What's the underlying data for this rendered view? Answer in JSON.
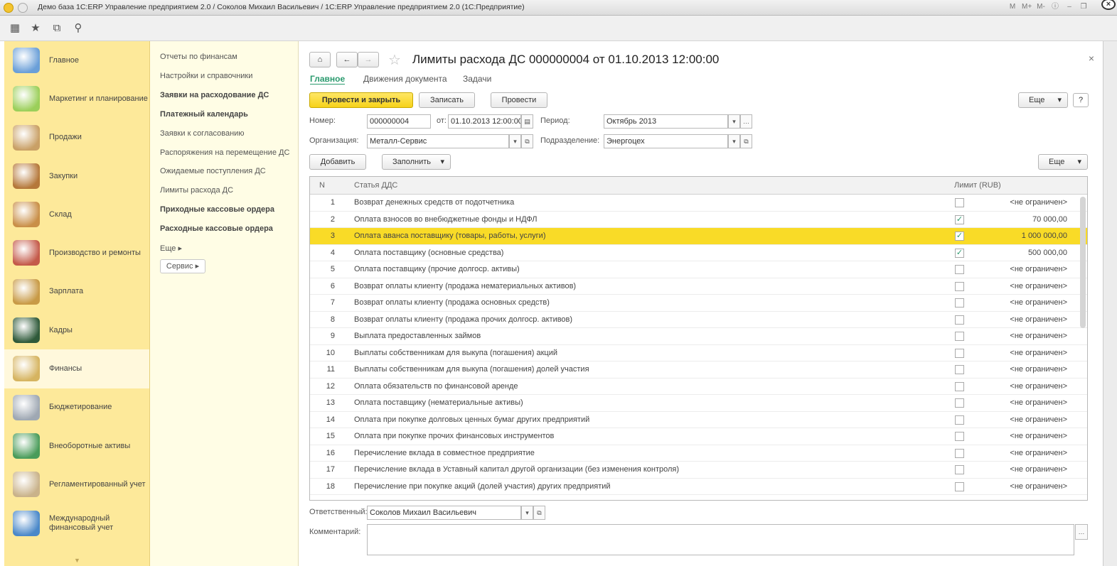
{
  "window": {
    "title": "Демо база 1С:ERP Управление предприятием 2.0 / Соколов Михаил Васильевич / 1С:ERP Управление предприятием 2.0 (1С:Предприятие)",
    "tools": [
      "M",
      "M+",
      "M-"
    ]
  },
  "sections": [
    {
      "label": "Главное",
      "icon": "home-desk-icon",
      "color": "#6a9fd8"
    },
    {
      "label": "Маркетинг и планирование",
      "icon": "pie-chart-icon",
      "color": "#9bcf5a"
    },
    {
      "label": "Продажи",
      "icon": "truck-icon",
      "color": "#c9a066"
    },
    {
      "label": "Закупки",
      "icon": "boxes-icon",
      "color": "#b5783a"
    },
    {
      "label": "Склад",
      "icon": "warehouse-shelf-icon",
      "color": "#c98f48"
    },
    {
      "label": "Производство и ремонты",
      "icon": "factory-icon",
      "color": "#c45a4a"
    },
    {
      "label": "Зарплата",
      "icon": "abacus-icon",
      "color": "#c89a46"
    },
    {
      "label": "Кадры",
      "icon": "passport-icon",
      "color": "#2f5a3a"
    },
    {
      "label": "Финансы",
      "icon": "coins-icon",
      "color": "#d6b460"
    },
    {
      "label": "Бюджетирование",
      "icon": "calculator-icon",
      "color": "#9fa8b3"
    },
    {
      "label": "Внеоборотные активы",
      "icon": "building-icon",
      "color": "#4a9c5a"
    },
    {
      "label": "Регламентированный учет",
      "icon": "laptop-icon",
      "color": "#c9b28a"
    },
    {
      "label": "Международный финансовый учет",
      "icon": "globe-coins-icon",
      "color": "#4a88c9"
    }
  ],
  "active_section": "Финансы",
  "submenu": {
    "items": [
      {
        "label": "Отчеты по финансам",
        "bold": false
      },
      {
        "label": "Настройки и справочники",
        "bold": false
      },
      {
        "label": "Заявки на расходование ДС",
        "bold": true
      },
      {
        "label": "Платежный календарь",
        "bold": true
      },
      {
        "label": "Заявки к согласованию",
        "bold": false
      },
      {
        "label": "Распоряжения на перемещение ДС",
        "bold": false
      },
      {
        "label": "Ожидаемые поступления ДС",
        "bold": false
      },
      {
        "label": "Лимиты расхода ДС",
        "bold": false
      },
      {
        "label": "Приходные кассовые ордера",
        "bold": true
      },
      {
        "label": "Расходные кассовые ордера",
        "bold": true
      },
      {
        "label": "Еще ▸",
        "bold": false
      }
    ],
    "service_label": "Сервис ▸"
  },
  "form": {
    "title": "Лимиты расхода ДС 000000004 от 01.10.2013 12:00:00",
    "tabs": [
      "Главное",
      "Движения документа",
      "Задачи"
    ],
    "buttons": {
      "post_close": "Провести и закрыть",
      "save": "Записать",
      "post": "Провести",
      "more": "Еще",
      "help": "?",
      "add": "Добавить",
      "fill": "Заполнить",
      "more2": "Еще"
    },
    "number_label": "Номер:",
    "number_value": "000000004",
    "from_label": "от:",
    "date_value": "01.10.2013 12:00:00",
    "period_label": "Период:",
    "period_value": "Октябрь 2013",
    "org_label": "Организация:",
    "org_value": "Металл-Сервис",
    "dept_label": "Подразделение:",
    "dept_value": "Энергоцех",
    "responsible_label": "Ответственный:",
    "responsible_value": "Соколов Михаил Васильевич",
    "comment_label": "Комментарий:"
  },
  "table": {
    "columns": [
      "N",
      "Статья ДДС",
      "Лимит (RUB)"
    ],
    "selected_row": 3,
    "rows": [
      {
        "n": "1",
        "name": "Возврат денежных средств от подотчетника",
        "checked": false,
        "limit": "<не ограничен>"
      },
      {
        "n": "2",
        "name": "Оплата взносов во внебюджетные фонды и НДФЛ",
        "checked": true,
        "limit": "70 000,00"
      },
      {
        "n": "3",
        "name": "Оплата аванса поставщику (товары, работы, услуги)",
        "checked": true,
        "limit": "1 000 000,00"
      },
      {
        "n": "4",
        "name": "Оплата поставщику (основные средства)",
        "checked": true,
        "limit": "500 000,00"
      },
      {
        "n": "5",
        "name": "Оплата поставщику (прочие долгоср. активы)",
        "checked": false,
        "limit": "<не ограничен>"
      },
      {
        "n": "6",
        "name": "Возврат оплаты клиенту (продажа нематериальных активов)",
        "checked": false,
        "limit": "<не ограничен>"
      },
      {
        "n": "7",
        "name": "Возврат оплаты клиенту (продажа основных средств)",
        "checked": false,
        "limit": "<не ограничен>"
      },
      {
        "n": "8",
        "name": "Возврат оплаты клиенту (продажа прочих долгоср. активов)",
        "checked": false,
        "limit": "<не ограничен>"
      },
      {
        "n": "9",
        "name": "Выплата предоставленных займов",
        "checked": false,
        "limit": "<не ограничен>"
      },
      {
        "n": "10",
        "name": "Выплаты собственникам для выкупа (погашения) акций",
        "checked": false,
        "limit": "<не ограничен>"
      },
      {
        "n": "11",
        "name": "Выплаты собственникам для выкупа (погашения) долей участия",
        "checked": false,
        "limit": "<не ограничен>"
      },
      {
        "n": "12",
        "name": "Оплата обязательств по финансовой аренде",
        "checked": false,
        "limit": "<не ограничен>"
      },
      {
        "n": "13",
        "name": "Оплата поставщику (нематериальные активы)",
        "checked": false,
        "limit": "<не ограничен>"
      },
      {
        "n": "14",
        "name": "Оплата при покупке долговых ценных бумаг других предприятий",
        "checked": false,
        "limit": "<не ограничен>"
      },
      {
        "n": "15",
        "name": "Оплата при покупке прочих финансовых инструментов",
        "checked": false,
        "limit": "<не ограничен>"
      },
      {
        "n": "16",
        "name": "Перечисление вклада в совместное предприятие",
        "checked": false,
        "limit": "<не ограничен>"
      },
      {
        "n": "17",
        "name": "Перечисление вклада в Уставный капитал другой организации (без изменения контроля)",
        "checked": false,
        "limit": "<не ограничен>"
      },
      {
        "n": "18",
        "name": "Перечисление при покупке акций (долей участия) других предприятий",
        "checked": false,
        "limit": "<не ограничен>"
      }
    ]
  },
  "colors": {
    "sections_bg": "#fde99a",
    "submenu_bg": "#fffde5",
    "primary_button": "#f6d21a",
    "selected_row": "#f9db27",
    "tab_active": "#2a9a6e"
  }
}
